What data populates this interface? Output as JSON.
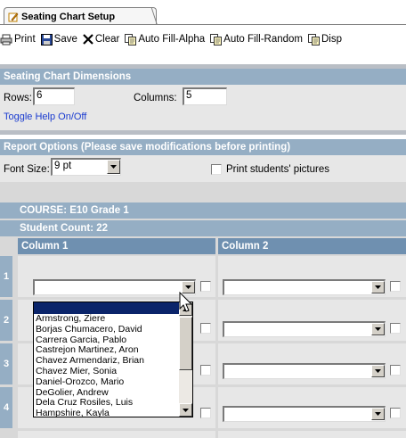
{
  "tab": {
    "label": "Seating Chart Setup",
    "icon": "pencil-icon"
  },
  "toolbar": {
    "print": "Print",
    "save": "Save",
    "clear": "Clear",
    "autofill_alpha": "Auto Fill-Alpha",
    "autofill_random": "Auto Fill-Random",
    "display": "Disp"
  },
  "dimensions": {
    "title": "Seating Chart Dimensions",
    "rows_label": "Rows:",
    "rows_value": "6",
    "columns_label": "Columns:",
    "columns_value": "5",
    "help_link": "Toggle Help On/Off"
  },
  "report": {
    "title": "Report Options (Please save modifications before printing)",
    "font_size_label": "Font Size:",
    "font_size_value": "9 pt",
    "print_pictures_label": "Print students' pictures"
  },
  "course": {
    "course_label": "COURSE: E10 Grade 1",
    "student_count": "Student Count: 22"
  },
  "grid": {
    "columns": [
      "Column 1",
      "Column 2"
    ],
    "rows": [
      "1",
      "2",
      "3",
      "4"
    ]
  },
  "dropdown_options": [
    "Armstrong, Ziere",
    "Borjas Chumacero, David",
    "Carrera Garcia, Pablo",
    "Castrejon Martinez, Aron",
    "Chavez Armendariz, Brian",
    "Chavez Mier, Sonia",
    "Daniel-Orozco, Mario",
    "DeGolier, Andrew",
    "Dela Cruz Rosiles, Luis",
    "Hampshire, Kayla"
  ],
  "colors": {
    "panel_header": "#95aec4",
    "column_header": "#6f90b0",
    "selection": "#0a246a",
    "link": "#1a3bd0"
  }
}
